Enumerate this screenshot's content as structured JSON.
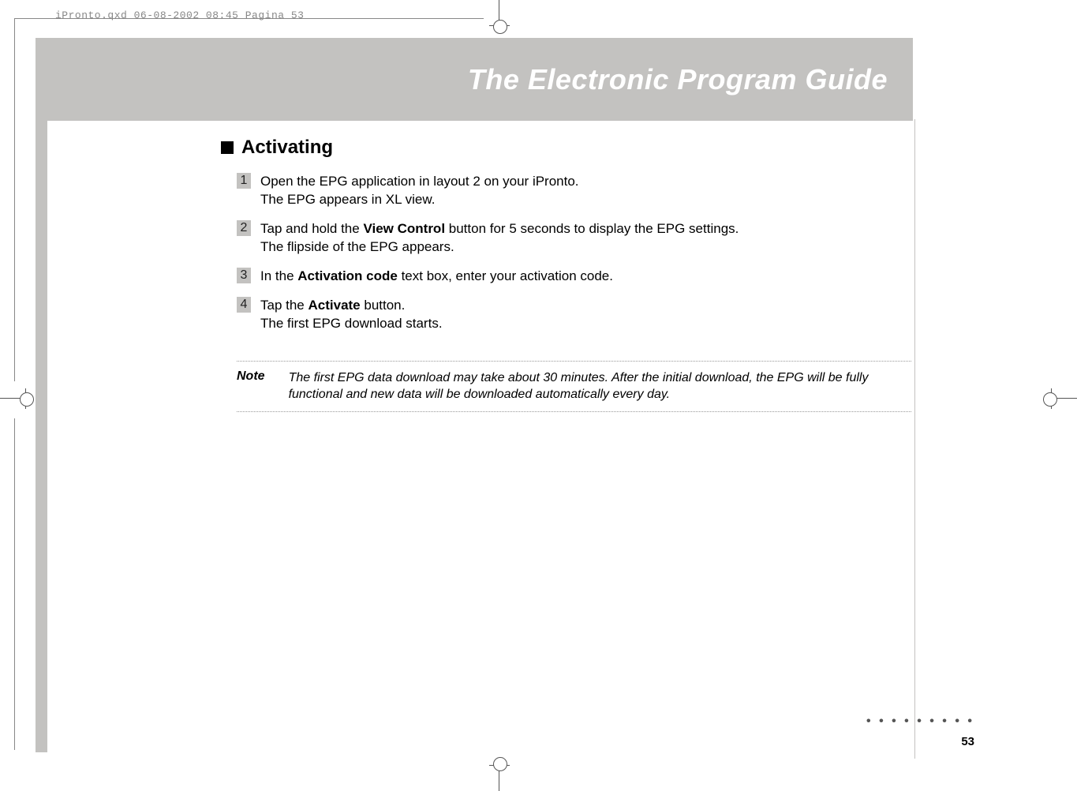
{
  "header": {
    "jobline": "iPronto.qxd  06-08-2002  08:45  Pagina 53"
  },
  "banner": {
    "title": "The Electronic Program Guide"
  },
  "section": {
    "heading": "Activating"
  },
  "steps": [
    {
      "num": "1",
      "line1a": "Open the EPG application in layout 2 on your iPronto.",
      "line2": "The EPG appears in XL view."
    },
    {
      "num": "2",
      "line1a": "Tap and hold the ",
      "bold1": "View Control",
      "line1b": " button for 5 seconds to display the EPG settings.",
      "line2": "The flipside of the EPG appears."
    },
    {
      "num": "3",
      "line1a": "In the ",
      "bold1": "Activation code",
      "line1b": " text box, enter your activation code."
    },
    {
      "num": "4",
      "line1a": "Tap the ",
      "bold1": "Activate",
      "line1b": " button.",
      "line2": "The first EPG download starts."
    }
  ],
  "note": {
    "label": "Note",
    "text": "The first EPG data download may take about 30 minutes. After the initial download, the EPG will be fully functional and new data will be downloaded automatically every day."
  },
  "page": {
    "dots": "• • • • • • • • •",
    "number": "53"
  }
}
